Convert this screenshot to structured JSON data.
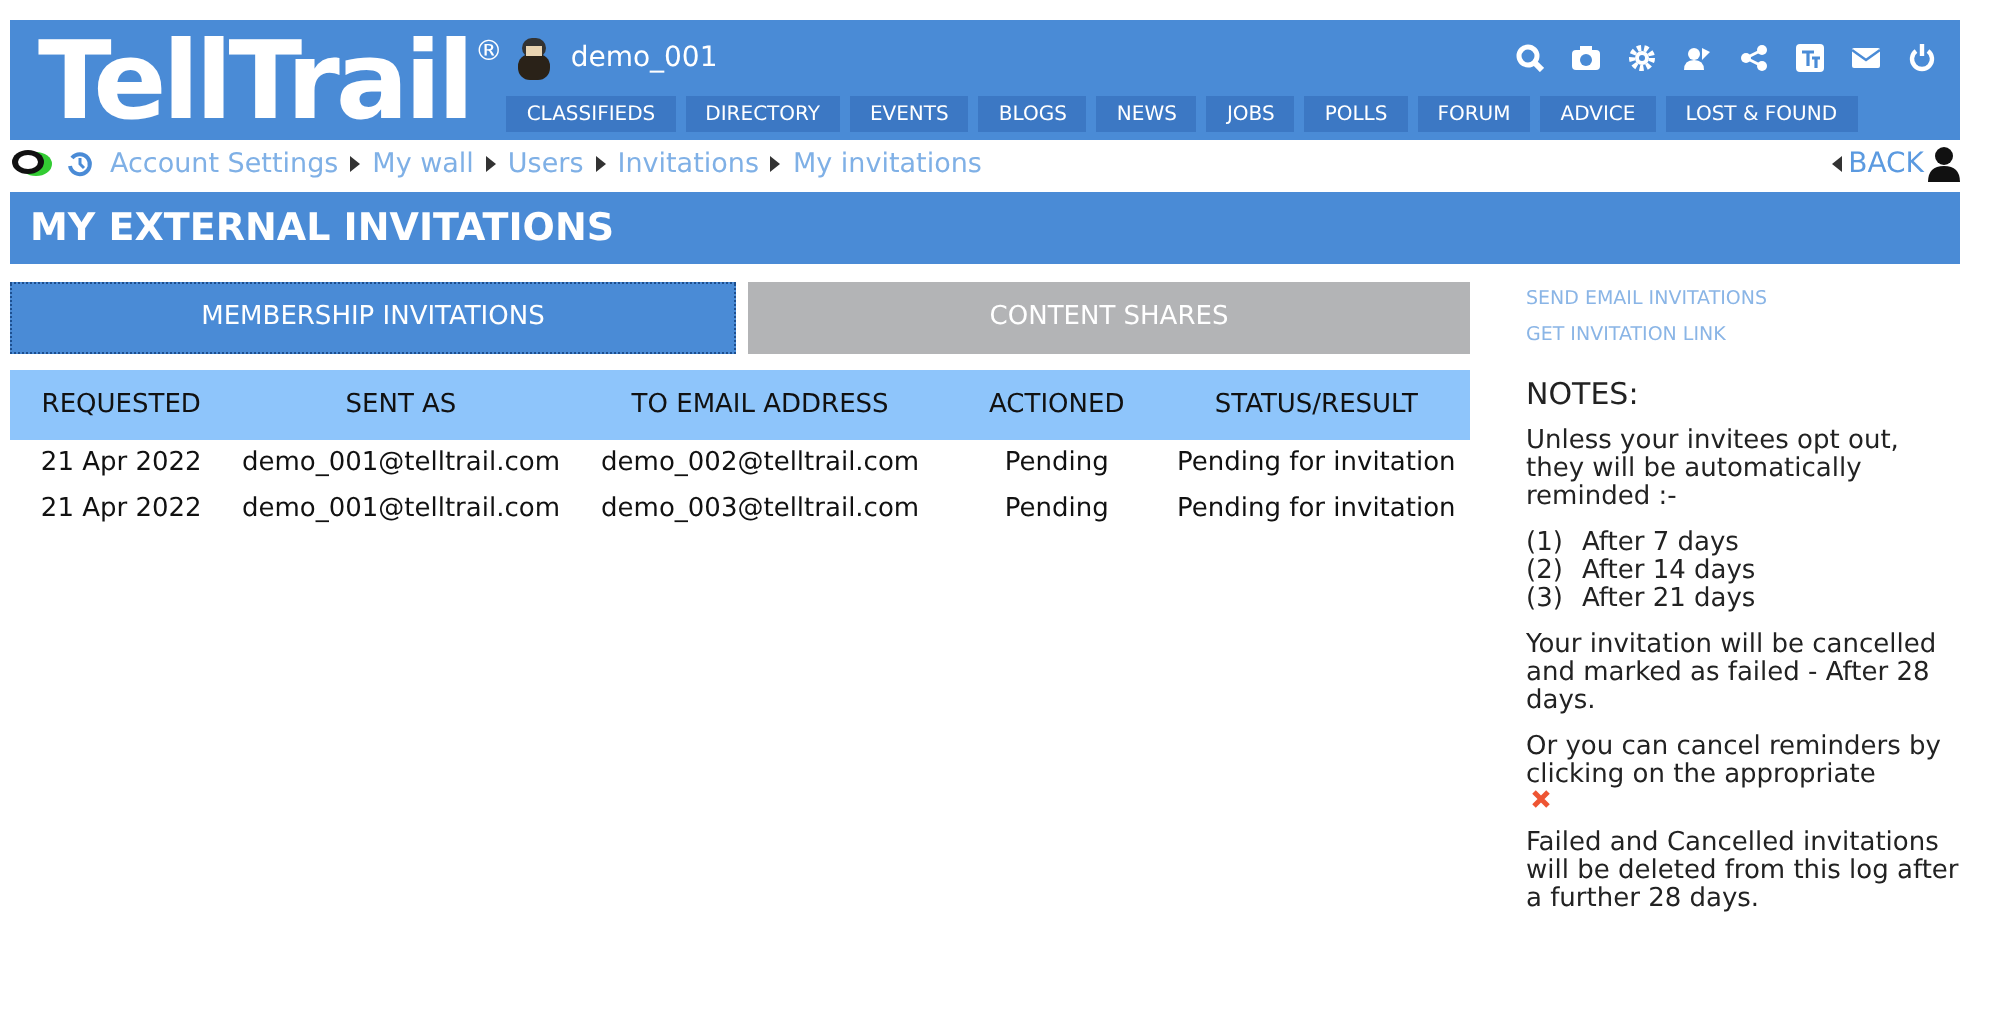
{
  "header": {
    "logo": "TellTrail",
    "registered_mark": "®",
    "username": "demo_001"
  },
  "nav": [
    {
      "label": "CLASSIFIEDS"
    },
    {
      "label": "DIRECTORY"
    },
    {
      "label": "EVENTS"
    },
    {
      "label": "BLOGS"
    },
    {
      "label": "NEWS"
    },
    {
      "label": "JOBS"
    },
    {
      "label": "POLLS"
    },
    {
      "label": "FORUM"
    },
    {
      "label": "ADVICE"
    },
    {
      "label": "LOST & FOUND"
    }
  ],
  "breadcrumb": [
    "Account Settings",
    "My wall",
    "Users",
    "Invitations",
    "My invitations"
  ],
  "back": "BACK",
  "page_title": "MY EXTERNAL INVITATIONS",
  "tabs": [
    {
      "label": "MEMBERSHIP INVITATIONS",
      "selected": true
    },
    {
      "label": "CONTENT SHARES",
      "selected": false
    }
  ],
  "table": {
    "columns": [
      "REQUESTED",
      "SENT AS",
      "TO EMAIL ADDRESS",
      "ACTIONED",
      "STATUS/RESULT"
    ],
    "rows": [
      [
        "21 Apr 2022",
        "demo_001@telltrail.com",
        "demo_002@telltrail.com",
        "Pending",
        "Pending for invitation"
      ],
      [
        "21 Apr 2022",
        "demo_001@telltrail.com",
        "demo_003@telltrail.com",
        "Pending",
        "Pending for invitation"
      ]
    ]
  },
  "side_links": [
    "SEND EMAIL INVITATIONS",
    "GET INVITATION LINK"
  ],
  "notes": {
    "heading": "NOTES:",
    "intro": "Unless your invitees opt out, they will be automatically reminded :-",
    "reminders": [
      {
        "number": "(1)",
        "text": "After 7 days"
      },
      {
        "number": "(2)",
        "text": "After 14 days"
      },
      {
        "number": "(3)",
        "text": "After 21 days"
      }
    ],
    "failed": "Your invitation will be cancelled and marked as failed - After 28 days.",
    "cancel": "Or you can cancel reminders by clicking on the appropriate",
    "deleted": "Failed and Cancelled invitations will be deleted from this log after a further 28 days."
  }
}
